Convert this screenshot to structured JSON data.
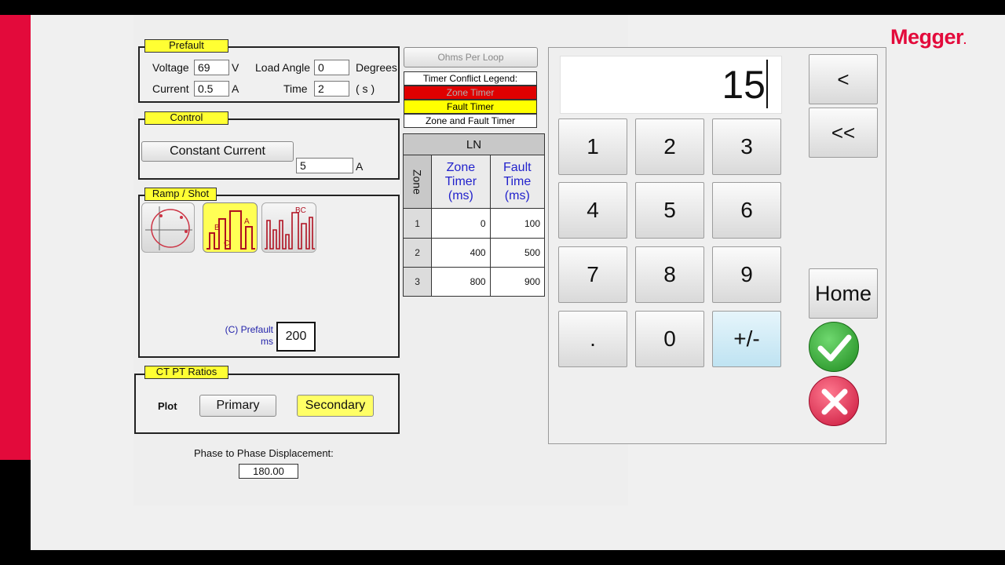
{
  "brand": {
    "logo": "Megger",
    "logo_dot": "."
  },
  "prefault": {
    "title": "Prefault",
    "voltage_label": "Voltage",
    "voltage_value": "69",
    "voltage_unit": "V",
    "load_angle_label": "Load Angle",
    "load_angle_value": "0",
    "load_angle_unit": "Degrees",
    "current_label": "Current",
    "current_value": "0.5",
    "current_unit": "A",
    "time_label": "Time",
    "time_value": "2",
    "time_unit": "( s )"
  },
  "control": {
    "title": "Control",
    "mode_button": "Constant Current",
    "value": "5",
    "unit": "A"
  },
  "ramp_shot": {
    "title": "Ramp / Shot",
    "icons": [
      "circle-plot-icon",
      "shot-abc-icon",
      "pulse-train-icon"
    ],
    "prefault_label_line1": "(C) Prefault",
    "prefault_label_line2": "ms",
    "prefault_value": "200"
  },
  "ct_pt": {
    "title": "CT PT Ratios",
    "plot_label": "Plot",
    "primary_button": "Primary",
    "secondary_button": "Secondary"
  },
  "displacement": {
    "label": "Phase to Phase Displacement:",
    "value": "180.00"
  },
  "ohms_button": "Ohms Per Loop",
  "legend": {
    "title": "Timer Conflict Legend:",
    "zone_timer": "Zone Timer",
    "fault_timer": "Fault Timer",
    "zone_and_fault": "Zone and Fault Timer",
    "colors": {
      "zone": "#e00000",
      "fault": "#ffff00"
    }
  },
  "zone_table": {
    "header": "LN",
    "zone_col": "Zone",
    "col1": "Zone Timer (ms)",
    "col2": "Fault Time (ms)",
    "rows": [
      {
        "zone": "1",
        "zone_timer": "0",
        "fault_time": "100"
      },
      {
        "zone": "2",
        "zone_timer": "400",
        "fault_time": "500"
      },
      {
        "zone": "3",
        "zone_timer": "800",
        "fault_time": "900"
      }
    ]
  },
  "keypad": {
    "display": "15",
    "keys": [
      "1",
      "2",
      "3",
      "4",
      "5",
      "6",
      "7",
      "8",
      "9",
      ".",
      "0",
      "+/-"
    ],
    "backspace": "<",
    "clear": "<<",
    "home": "Home"
  }
}
